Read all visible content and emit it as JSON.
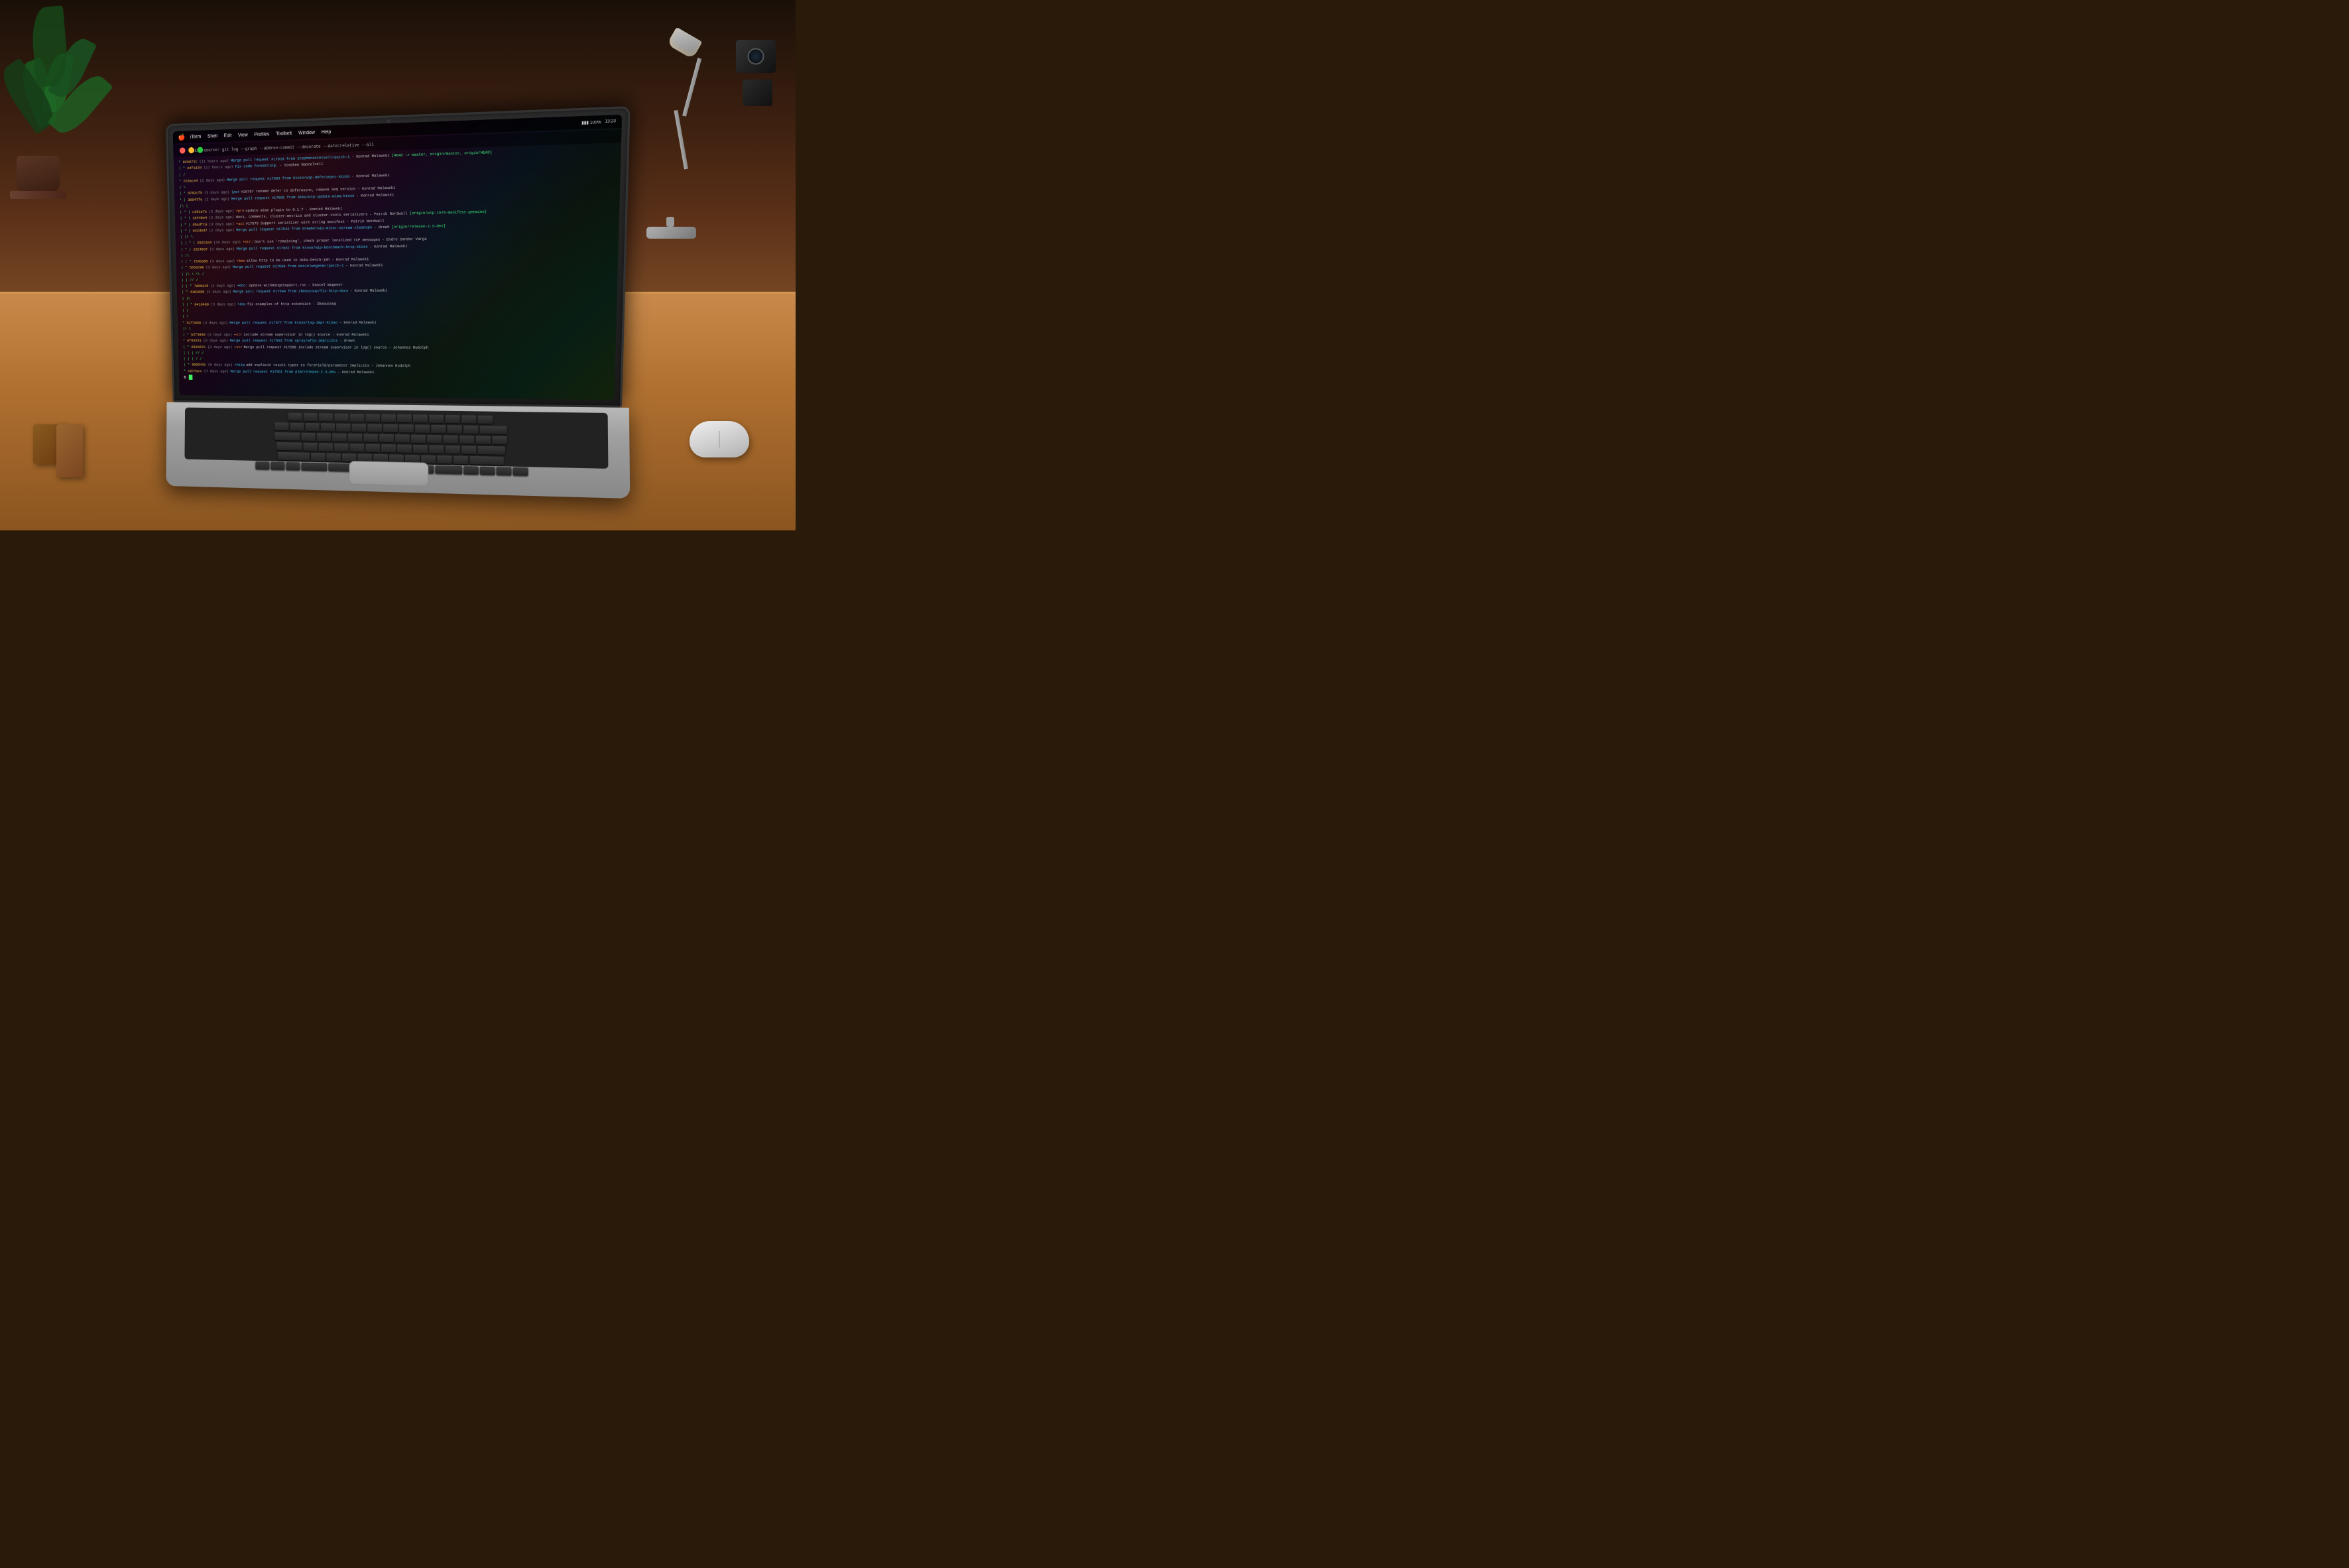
{
  "room": {
    "description": "MacBook laptop on wooden desk with terminal open"
  },
  "menubar": {
    "apple": "🍎",
    "items": [
      {
        "label": "iTerm"
      },
      {
        "label": "Shell"
      },
      {
        "label": "Edit"
      },
      {
        "label": "View"
      },
      {
        "label": "Profiles"
      },
      {
        "label": "Toolbelt"
      },
      {
        "label": "Window"
      },
      {
        "label": "Help"
      }
    ],
    "right_items": [
      "signal-icons",
      "battery",
      "time-13:23"
    ]
  },
  "terminal": {
    "command_bar": "akka-source: git log --graph --abbrev-commit --decorate --date=relative --all",
    "lines": [
      {
        "hash": "826072c",
        "time": "(11 hours ago)",
        "msg": "Merge pull request #17619 from stephenancelvell/patch-1 - Konrad Malawski [HEAD -> master, origin/master, origin/HEAD]"
      },
      {
        "hash": "e4fa103",
        "time": "(11 hours ago)",
        "msg": "Fix code formatting. - Stephen Nancelvell"
      },
      {
        "hash": "",
        "time": "",
        "msg": "//"
      },
      {
        "hash": "228ace4",
        "time": "(2 days ago)",
        "msg": "Merge pull request #17593 from ktoso/wip-deferasync-ktoso - Konrad Malawski"
      },
      {
        "hash": "",
        "time": "",
        "msg": "//"
      },
      {
        "hash": "d782cf5",
        "time": "(3 days ago)",
        "msg": "|per #16797 rename defer to deferAsync, remove Seq version - Konrad Malawski"
      },
      {
        "hash": "30647fe",
        "time": "(2 days ago)",
        "msg": "Merge pull request #17605 from akka/wip-update-mima-ktoso - Konrad Malawski"
      },
      {
        "hash": "",
        "time": "",
        "msg": "| |"
      },
      {
        "hash": "c391e7e",
        "time": "(2 days ago)",
        "msg": "+pro update mime plugin to 0.1.7 - Konrad Malawski"
      },
      {
        "hash": "1d44be4",
        "time": "(2 days ago)",
        "msg": "docs, comments, cluster-metrics and cluster-tools serializers - Patrik Nordwall [origin/wip-1576-manifest-getmine]"
      },
      {
        "hash": "d5adfca",
        "time": "(3 days ago)",
        "msg": "+act #17576 Support serializer with string manifest - Patrik Nordwall"
      },
      {
        "hash": "642ded7",
        "time": "(2 days ago)",
        "msg": "Merge pull request #17544 from drewhk/wip-minor-stream-cleanups - drewh [origin/release-2.3-dev]"
      },
      {
        "hash": "",
        "time": "",
        "msg": "| | \\"
      },
      {
        "hash": "262c5a4",
        "time": "(10 days ago)",
        "msg": "+str: Don't use 'remaining', check proper localized TCP messages - Endre Sandor Varga"
      },
      {
        "hash": "1524867",
        "time": "(3 days ago)",
        "msg": "Merge pull request #17682 from ktoso/wip-benchmark-http-ktoso - Konrad Malawski"
      },
      {
        "hash": "",
        "time": "",
        "msg": "| | \\"
      },
      {
        "hash": "754b885",
        "time": "(3 days ago)",
        "msg": "+ben allow http to be used in akka-bench-jmh - Konrad Malawski"
      },
      {
        "hash": "5660290",
        "time": "(3 days ago)",
        "msg": "Merge pull request #17598 from danielwegener/patch-1 - Konrad Malawski"
      },
      {
        "hash": "",
        "time": "",
        "msg": "| | | | \\\\ /"
      },
      {
        "hash": "",
        "time": "",
        "msg": "| | // /"
      },
      {
        "hash": "7a06a26",
        "time": "(4 days ago)",
        "msg": "+doc: Update withRangeSupport.rst - Daniel Wegener"
      },
      {
        "hash": "4182d88",
        "time": "(3 days ago)",
        "msg": "Merge pull request #17594 from 2beaucoup/fix-http-docs - Konrad Malawski"
      },
      {
        "hash": "",
        "time": "",
        "msg": "| | \\"
      },
      {
        "hash": "041d4b9",
        "time": "(3 days ago)",
        "msg": "+doc fix examples of http extension - 2beaucoup"
      },
      {
        "hash": "",
        "time": "",
        "msg": "| |"
      },
      {
        "hash": "",
        "time": "",
        "msg": "| \\"
      },
      {
        "hash": "b2f3899",
        "time": "(3 days ago)",
        "msg": "Merge pull request #17577 from ktoso/log-impr-ktoso - Konrad Malawski"
      },
      {
        "hash": "",
        "time": "",
        "msg": "| \\ \\"
      },
      {
        "hash": "b2f3899",
        "time": "(3 days ago)",
        "msg": "+str include stream supervisor in log() source - Konrad Malawski"
      },
      {
        "hash": "ef93291",
        "time": "(5 days ago)",
        "msg": "Merge pull request #17553 from spray/wfix-implicits - drewh"
      },
      {
        "hash": "051b57c",
        "time": "(3 days ago)",
        "msg": "+str Merge pull request #17298 include stream supervisor in log() source - Johannes Rudolph"
      },
      {
        "hash": "",
        "time": "",
        "msg": "| | | // /"
      },
      {
        "hash": "",
        "time": "",
        "msg": "| | | / /"
      },
      {
        "hash": "859043c",
        "time": "(9 days ago)",
        "msg": "+http add explicit result types to foreField/parameter Implicits - Johannes Rudolph"
      },
      {
        "hash": "c977acc",
        "time": "(7 days ago)",
        "msg": "Merge pull request #17561 from plm/release-2.3-dev - Konrad Malawski"
      }
    ]
  }
}
